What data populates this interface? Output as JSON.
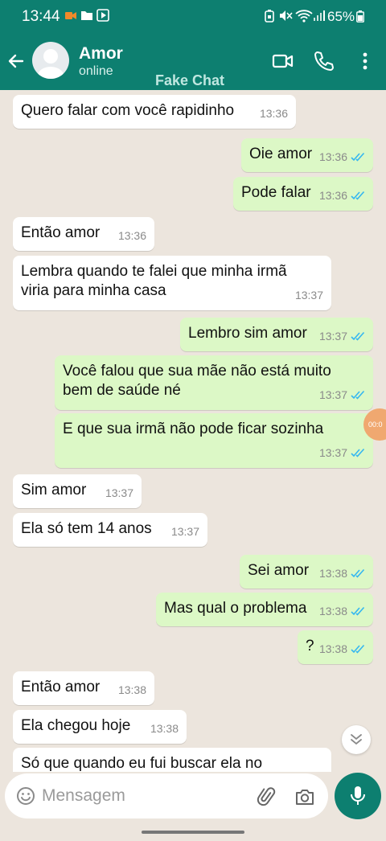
{
  "status_bar": {
    "time": "13:44",
    "battery": "65%",
    "icons": [
      "record-icon",
      "folder-icon",
      "play-store-icon",
      "alarm-icon",
      "mute-icon",
      "wifi-icon",
      "signal-icon",
      "battery-icon"
    ]
  },
  "header": {
    "contact_name": "Amor",
    "contact_status": "online",
    "watermark": "Fake Chat",
    "icons": [
      "back-arrow-icon",
      "avatar",
      "video-call-icon",
      "phone-icon",
      "more-vert-icon"
    ]
  },
  "messages": [
    {
      "dir": "in",
      "text": "Quero falar com você rapidinho",
      "time": "13:36"
    },
    {
      "dir": "out",
      "text": "Oie amor",
      "time": "13:36"
    },
    {
      "dir": "out",
      "text": "Pode falar",
      "time": "13:36"
    },
    {
      "dir": "in",
      "text": "Então amor",
      "time": "13:36"
    },
    {
      "dir": "in",
      "text": "Lembra quando te falei que minha irmã\nviria para minha casa",
      "time": "13:37"
    },
    {
      "dir": "out",
      "text": "Lembro sim amor",
      "time": "13:37"
    },
    {
      "dir": "out",
      "text": "Você falou que sua mãe não está muito\nbem de saúde né",
      "time": "13:37"
    },
    {
      "dir": "out",
      "text": "E que sua irmã não pode ficar sozinha",
      "time": "13:37"
    },
    {
      "dir": "in",
      "text": "Sim amor",
      "time": "13:37"
    },
    {
      "dir": "in",
      "text": "Ela só tem 14 anos",
      "time": "13:37"
    },
    {
      "dir": "out",
      "text": "Sei amor",
      "time": "13:38"
    },
    {
      "dir": "out",
      "text": "Mas qual o problema",
      "time": "13:38"
    },
    {
      "dir": "out",
      "text": "?",
      "time": "13:38"
    },
    {
      "dir": "in",
      "text": "Então amor",
      "time": "13:38"
    },
    {
      "dir": "in",
      "text": "Ela chegou hoje",
      "time": "13:38"
    },
    {
      "dir": "in",
      "text": "Só que quando eu fui buscar ela no",
      "time": ""
    }
  ],
  "recording_badge": "00:0",
  "composer": {
    "placeholder": "Mensagem",
    "icons": [
      "emoji-icon",
      "attach-icon",
      "camera-icon",
      "mic-icon"
    ]
  },
  "colors": {
    "header": "#0d7f70",
    "chat_bg": "#ece5dd",
    "outgoing": "#dcf8c6",
    "incoming": "#ffffff",
    "read_ticks": "#34b7f1"
  }
}
